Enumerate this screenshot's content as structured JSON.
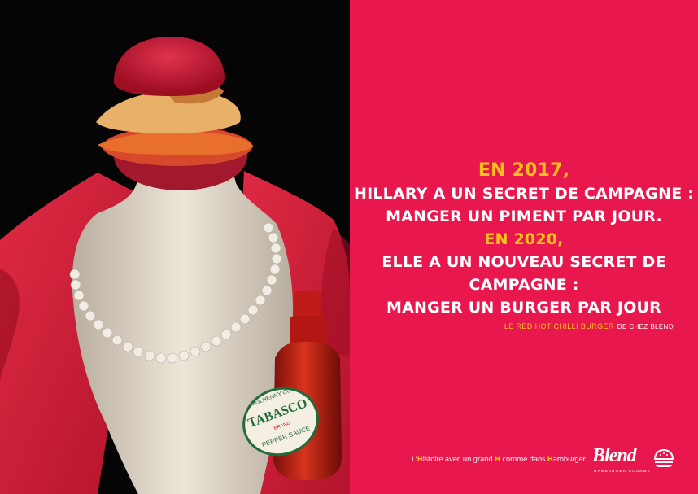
{
  "ad": {
    "headline": {
      "year_1": "EN 2017,",
      "line_1": "HILLARY A UN SECRET DE CAMPAGNE :",
      "line_2": "MANGER UN PIMENT PAR JOUR.",
      "year_2": "EN 2020,",
      "line_3": "ELLE A UN NOUVEAU SECRET DE CAMPAGNE :",
      "line_4": "MANGER UN BURGER PAR JOUR"
    },
    "product_name": "LE RED HOT CHILLI BURGER",
    "product_maker": "DE CHEZ BLEND",
    "tagline": {
      "part_1": "L'",
      "h_1": "H",
      "part_2": "istoire avec un grand ",
      "h_2": "H",
      "part_3": " comme dans ",
      "h_3": "H",
      "part_4": "amburger"
    },
    "logo": {
      "brand": "Blend",
      "sub": "HAMBURGER GOURMET"
    },
    "bottle_label": {
      "brand": "TABASCO",
      "maker": "McILHENNY CO.",
      "brand_mark": "BRAND",
      "product": "PEPPER SAUCE"
    }
  },
  "colors": {
    "panel": "#e8184e",
    "accent": "#f8c21a",
    "background": "#050505",
    "jacket": "#d81f3c"
  }
}
